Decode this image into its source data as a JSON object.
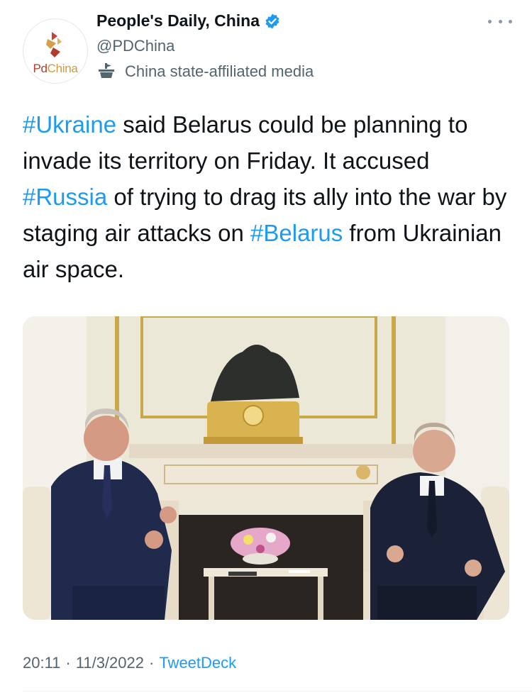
{
  "account": {
    "avatar_text_pd": "Pd",
    "avatar_text_china": "China",
    "display_name": "People's Daily, China",
    "handle": "@PDChina",
    "affiliation": "China state-affiliated media",
    "verified": true
  },
  "tweet": {
    "segments": [
      {
        "text": "#Ukraine",
        "hashtag": true
      },
      {
        "text": " said Belarus could be planning to invade its territory on Friday. It accused ",
        "hashtag": false
      },
      {
        "text": "#Russia",
        "hashtag": true
      },
      {
        "text": " of trying to drag its ally into the war by staging air attacks on ",
        "hashtag": false
      },
      {
        "text": "#Belarus",
        "hashtag": true
      },
      {
        "text": " from Ukrainian air space.",
        "hashtag": false
      }
    ]
  },
  "meta": {
    "time": "20:11",
    "separator": "·",
    "date": "11/3/2022",
    "source": "TweetDeck"
  },
  "colors": {
    "link": "#1d9bf0",
    "secondary_text": "#536471",
    "verified_badge": "#1d9bf0"
  },
  "icons": [
    "verified-badge-icon",
    "state-media-icon",
    "more-options-icon"
  ]
}
